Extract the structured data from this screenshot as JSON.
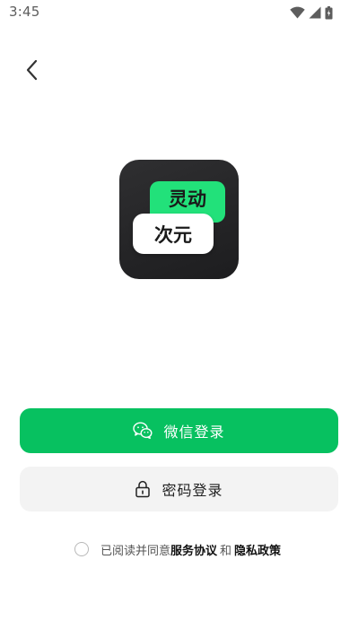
{
  "status_bar": {
    "time": "3:45"
  },
  "logo": {
    "top_text": "灵动",
    "bottom_text": "次元",
    "colors": {
      "background": "#232325",
      "green_bubble": "#22e17a",
      "white_bubble": "#ffffff"
    }
  },
  "buttons": {
    "wechat_login": {
      "label": "微信登录",
      "icon": "wechat-icon",
      "color": "#07c160"
    },
    "password_login": {
      "label": "密码登录",
      "icon": "lock-icon",
      "color": "#f3f3f3"
    }
  },
  "agreement": {
    "prefix": "已阅读并同意",
    "service_link": "服务协议",
    "and": "和",
    "privacy_link": "隐私政策",
    "checked": false
  }
}
